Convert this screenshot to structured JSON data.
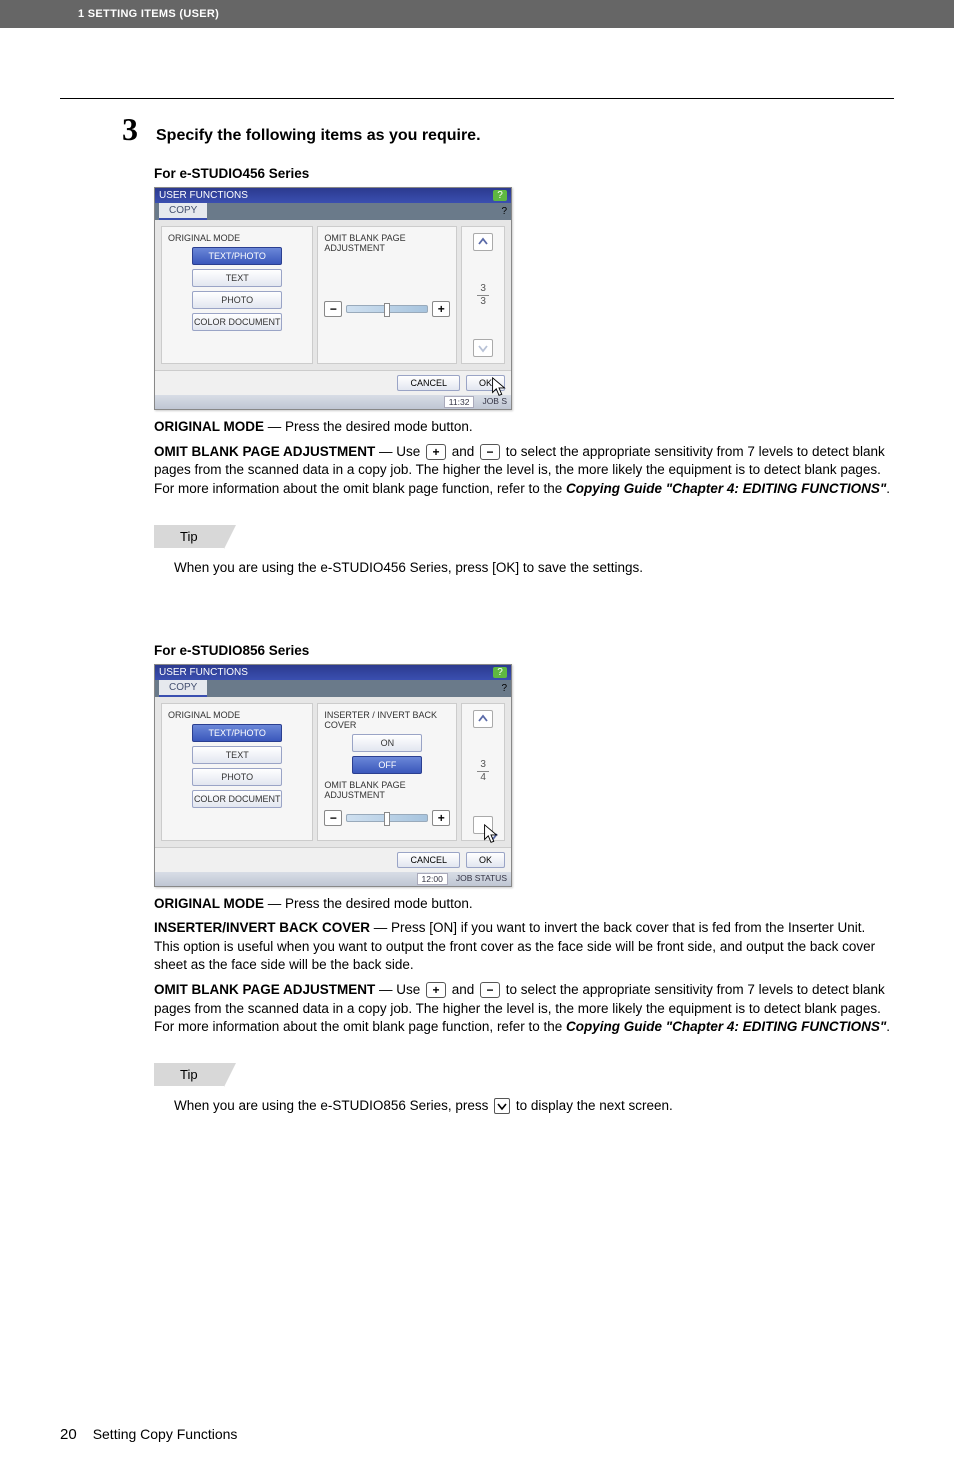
{
  "header": {
    "breadcrumb": "1 SETTING ITEMS (USER)"
  },
  "step": {
    "number": "3",
    "instruction": "Specify the following items as you require."
  },
  "series456": {
    "heading": "For e-STUDIO456 Series",
    "screenshot": {
      "windowTitle": "USER FUNCTIONS",
      "tab": "COPY",
      "leftLabel": "ORIGINAL MODE",
      "modes": [
        "TEXT/PHOTO",
        "TEXT",
        "PHOTO",
        "COLOR DOCUMENT"
      ],
      "selectedMode": "TEXT/PHOTO",
      "midLabel": "OMIT BLANK PAGE ADJUSTMENT",
      "pageFrac": "3\n3",
      "cancel": "CANCEL",
      "ok": "OK",
      "jobStatus": "JOB S",
      "time": "11:32"
    },
    "desc": {
      "originalMode": {
        "label": "ORIGINAL MODE",
        "text": " — Press the desired mode button."
      },
      "omit": {
        "label": "OMIT BLANK PAGE ADJUSTMENT",
        "lead": " — Use ",
        "mid": " and ",
        "tail1": " to select the appropriate sensitivity from 7 levels to detect blank pages from the scanned data in a copy job. The higher the level is, the more likely the equipment is to detect blank pages. For more information about the omit blank page function, refer to the ",
        "ref": "Copying Guide \"Chapter 4: EDITING FUNCTIONS\"",
        "tail2": "."
      }
    },
    "tip": {
      "label": "Tip",
      "text": "When you are using the e-STUDIO456 Series, press [OK] to save the settings."
    }
  },
  "series856": {
    "heading": "For e-STUDIO856 Series",
    "screenshot": {
      "windowTitle": "USER FUNCTIONS",
      "tab": "COPY",
      "leftLabel": "ORIGINAL MODE",
      "modes": [
        "TEXT/PHOTO",
        "TEXT",
        "PHOTO",
        "COLOR DOCUMENT"
      ],
      "selectedMode": "TEXT/PHOTO",
      "inserterLabel": "INSERTER / INVERT BACK COVER",
      "on": "ON",
      "off": "OFF",
      "omitLabel": "OMIT BLANK PAGE ADJUSTMENT",
      "pageFrac": "3\n4",
      "cancel": "CANCEL",
      "ok": "OK",
      "jobStatus": "JOB STATUS",
      "time": "12:00"
    },
    "desc": {
      "originalMode": {
        "label": "ORIGINAL MODE",
        "text": " — Press the desired mode button."
      },
      "inserter": {
        "label": "INSERTER/INVERT BACK COVER",
        "text": " — Press [ON] if you want to invert the back cover that is fed from the Inserter Unit. This option is useful when you want to output the front cover as the face side will be front side, and output the back cover sheet as the face side will be the back side."
      },
      "omit": {
        "label": "OMIT BLANK PAGE ADJUSTMENT",
        "lead": " — Use ",
        "mid": " and ",
        "tail1": " to select the appropriate sensitivity from 7 levels to detect blank pages from the scanned data in a copy job. The higher the level is, the more likely the equipment is to detect blank pages. For more information about the omit blank page function, refer to the ",
        "ref": "Copying Guide \"Chapter 4: EDITING FUNCTIONS\"",
        "tail2": "."
      }
    },
    "tip": {
      "label": "Tip",
      "lead": "When you are using the e-STUDIO856 Series, press ",
      "tail": " to display the next screen."
    }
  },
  "footer": {
    "page": "20",
    "title": "Setting Copy Functions"
  },
  "icons": {
    "plus": "+",
    "minus": "−"
  }
}
